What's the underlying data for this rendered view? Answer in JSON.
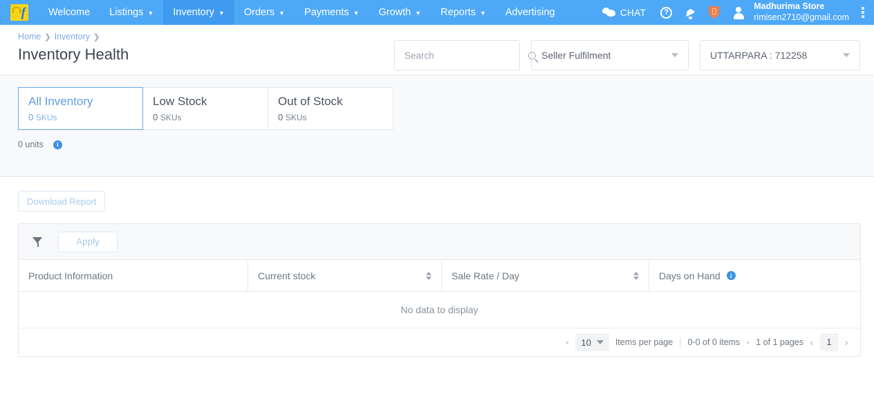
{
  "navbar": {
    "logo_letter": "f",
    "items": [
      {
        "label": "Welcome",
        "has_caret": false,
        "active": false
      },
      {
        "label": "Listings",
        "has_caret": true,
        "active": false
      },
      {
        "label": "Inventory",
        "has_caret": true,
        "active": true
      },
      {
        "label": "Orders",
        "has_caret": true,
        "active": false
      },
      {
        "label": "Payments",
        "has_caret": true,
        "active": false
      },
      {
        "label": "Growth",
        "has_caret": true,
        "active": false
      },
      {
        "label": "Reports",
        "has_caret": true,
        "active": false
      },
      {
        "label": "Advertising",
        "has_caret": false,
        "active": false
      }
    ],
    "chat_label": "CHAT",
    "help_glyph": "?",
    "user_name": "Madhurima Store",
    "user_email": "rimisen2710@gmail.com",
    "accent_blue": "#4da8f7",
    "active_blue": "#3f9bf0",
    "badge_orange": "#f07f46"
  },
  "header": {
    "breadcrumb": [
      "Home",
      "Inventory"
    ],
    "breadcrumb_separator": "❯",
    "title": "Inventory Health",
    "search": {
      "value": "",
      "placeholder": "Search"
    },
    "fulfilment_select": "Seller Fulfilment",
    "location_select": "UTTARPARA : 712258"
  },
  "tabs": {
    "items": [
      {
        "name": "All Inventory",
        "count": "0",
        "unit": "SKUs",
        "active": true
      },
      {
        "name": "Low Stock",
        "count": "0",
        "unit": "SKUs",
        "active": false
      },
      {
        "name": "Out of Stock",
        "count": "0",
        "unit": "SKUs",
        "active": false
      }
    ],
    "units_text": "0 units",
    "info_glyph": "i"
  },
  "toolbar": {
    "download_label": "Download Report",
    "apply_label": "Apply"
  },
  "table": {
    "columns": [
      {
        "label": "Product Information",
        "sortable": false,
        "info": false
      },
      {
        "label": "Current stock",
        "sortable": true,
        "info": false
      },
      {
        "label": "Sale Rate / Day",
        "sortable": true,
        "info": false
      },
      {
        "label": "Days on Hand",
        "sortable": false,
        "info": true
      }
    ],
    "rows": [],
    "empty_message": "No data to display",
    "info_glyph": "i"
  },
  "pagination": {
    "items_per_page_value": "10",
    "items_per_page_label": "Items per page",
    "item_range": "0-0 of 0 items",
    "page_range": "1 of 1 pages",
    "prev_glyph": "‹",
    "next_glyph": "›",
    "current_page": "1"
  }
}
